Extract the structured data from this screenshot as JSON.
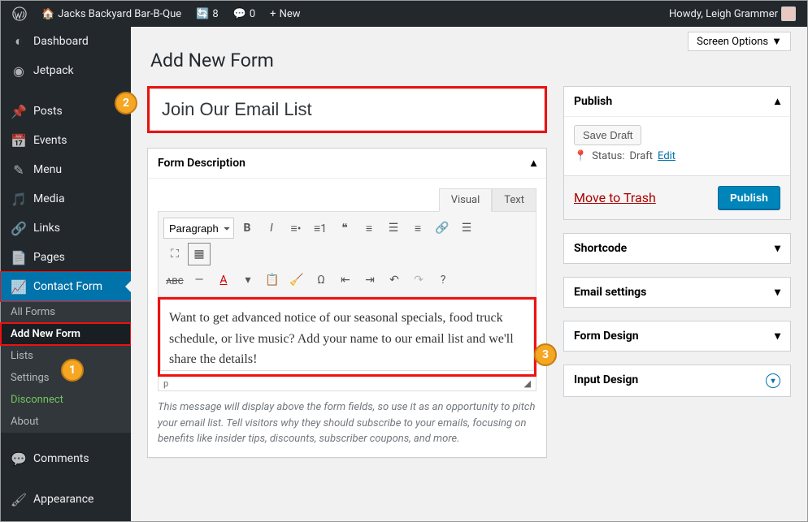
{
  "toolbar": {
    "site_name": "Jacks Backyard Bar-B-Que",
    "updates_count": "8",
    "comments_count": "0",
    "new_label": "New",
    "howdy": "Howdy, Leigh Grammer"
  },
  "sidebar": {
    "items": [
      {
        "icon": "dashboard",
        "label": "Dashboard"
      },
      {
        "icon": "jetpack",
        "label": "Jetpack"
      },
      {
        "icon": "pin",
        "label": "Posts"
      },
      {
        "icon": "calendar",
        "label": "Events"
      },
      {
        "icon": "menu",
        "label": "Menu"
      },
      {
        "icon": "media",
        "label": "Media"
      },
      {
        "icon": "links",
        "label": "Links"
      },
      {
        "icon": "pages",
        "label": "Pages"
      },
      {
        "icon": "contact",
        "label": "Contact Form"
      }
    ],
    "submenu": [
      {
        "label": "All Forms"
      },
      {
        "label": "Add New Form"
      },
      {
        "label": "Lists"
      },
      {
        "label": "Settings"
      },
      {
        "label": "Disconnect"
      },
      {
        "label": "About"
      }
    ],
    "comments_label": "Comments",
    "appearance_label": "Appearance"
  },
  "page": {
    "screen_options": "Screen Options",
    "heading": "Add New Form",
    "title_value": "Join Our Email List",
    "desc_box": "Form Description",
    "tabs": {
      "visual": "Visual",
      "text": "Text"
    },
    "paragraph_select": "Paragraph",
    "content": "Want to get advanced notice of our seasonal specials, food truck schedule, or live music? Add your name to our email list and we'll share the details!",
    "path": "p",
    "help": "This message will display above the form fields, so use it as an opportunity to pitch your email list. Tell visitors why they should subscribe to your emails, focusing on benefits like insider tips, discounts, subscriber coupons, and more."
  },
  "publish": {
    "heading": "Publish",
    "save_draft": "Save Draft",
    "status_label": "Status:",
    "status_value": "Draft",
    "edit": "Edit",
    "trash": "Move to Trash",
    "publish_btn": "Publish"
  },
  "sideboxes": [
    {
      "label": "Shortcode"
    },
    {
      "label": "Email settings"
    },
    {
      "label": "Form Design"
    },
    {
      "label": "Input Design"
    }
  ],
  "callouts": {
    "one": "1",
    "two": "2",
    "three": "3"
  }
}
